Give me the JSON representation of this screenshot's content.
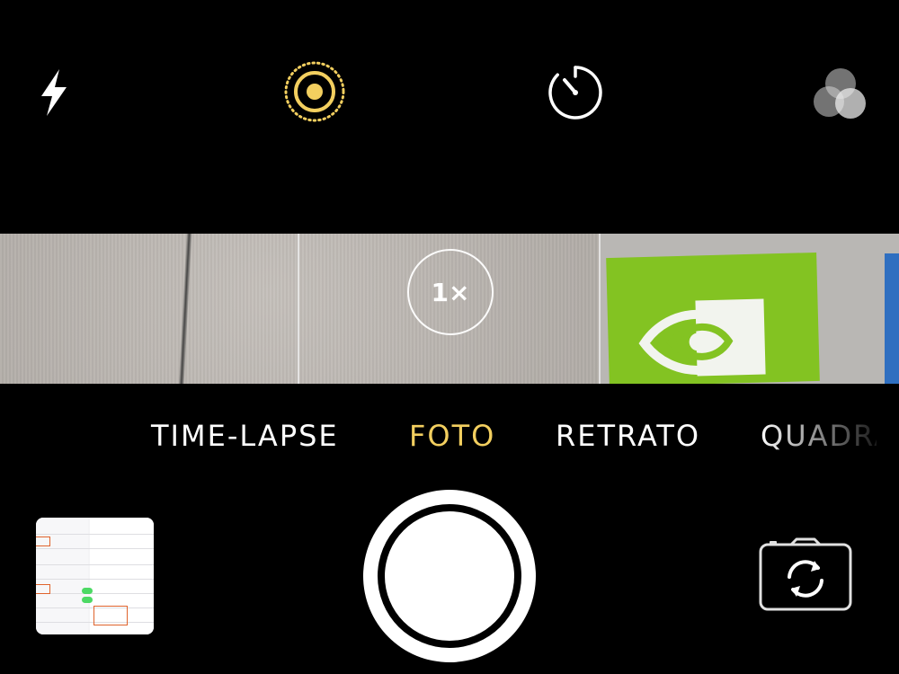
{
  "top_bar": {
    "flash_icon": "flash-icon",
    "live_photo_icon": "live-photo-icon",
    "timer_icon": "timer-icon",
    "filters_icon": "filters-icon"
  },
  "viewfinder": {
    "zoom_label": "1×"
  },
  "modes": {
    "items": [
      "TIME-LAPSE",
      "FOTO",
      "RETRATO",
      "QUADRADO"
    ],
    "selected": "FOTO"
  },
  "controls": {
    "shutter_icon": "shutter-button",
    "switch_camera_icon": "switch-camera-icon",
    "thumbnail_icon": "last-photo-thumbnail"
  },
  "colors": {
    "accent_yellow": "#f3cf5f",
    "background": "#000000",
    "white": "#ffffff"
  }
}
